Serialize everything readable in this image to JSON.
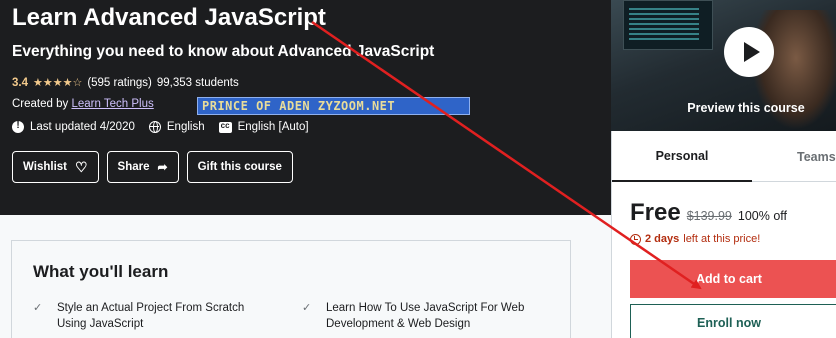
{
  "course": {
    "title": "Learn Advanced JavaScript",
    "subtitle": "Everything you need to know about Advanced JavaScript",
    "rating": "3.4",
    "stars": "★★★★☆",
    "ratings_count": "(595 ratings)",
    "students": "99,353 students",
    "created_by_label": "Created by",
    "instructor": "Learn Tech Plus",
    "watermark_text": "PRINCE OF ADEN ZYZOOM.NET",
    "last_updated": "Last updated 4/2020",
    "language": "English",
    "captions": "English [Auto]"
  },
  "actions": {
    "wishlist": "Wishlist",
    "share": "Share",
    "gift": "Gift this course"
  },
  "preview": {
    "label": "Preview this course"
  },
  "sidebar": {
    "tabs": [
      "Personal",
      "Teams"
    ],
    "price": "Free",
    "original_price": "$139.99",
    "discount": "100% off",
    "timer_bold": "2 days",
    "timer_rest": "left at this price!",
    "add_to_cart": "Add to cart",
    "enroll": "Enroll now"
  },
  "learn": {
    "title": "What you'll learn",
    "items": [
      "Style an Actual Project From Scratch Using JavaScript",
      "Learn How To Use JavaScript For Web Development & Web Design"
    ]
  },
  "colors": {
    "hero_bg": "#1c1d1f",
    "star": "#f3ca8c",
    "cart": "#ec5252",
    "enroll": "#1e6055",
    "annotation_arrow": "#e02020"
  }
}
